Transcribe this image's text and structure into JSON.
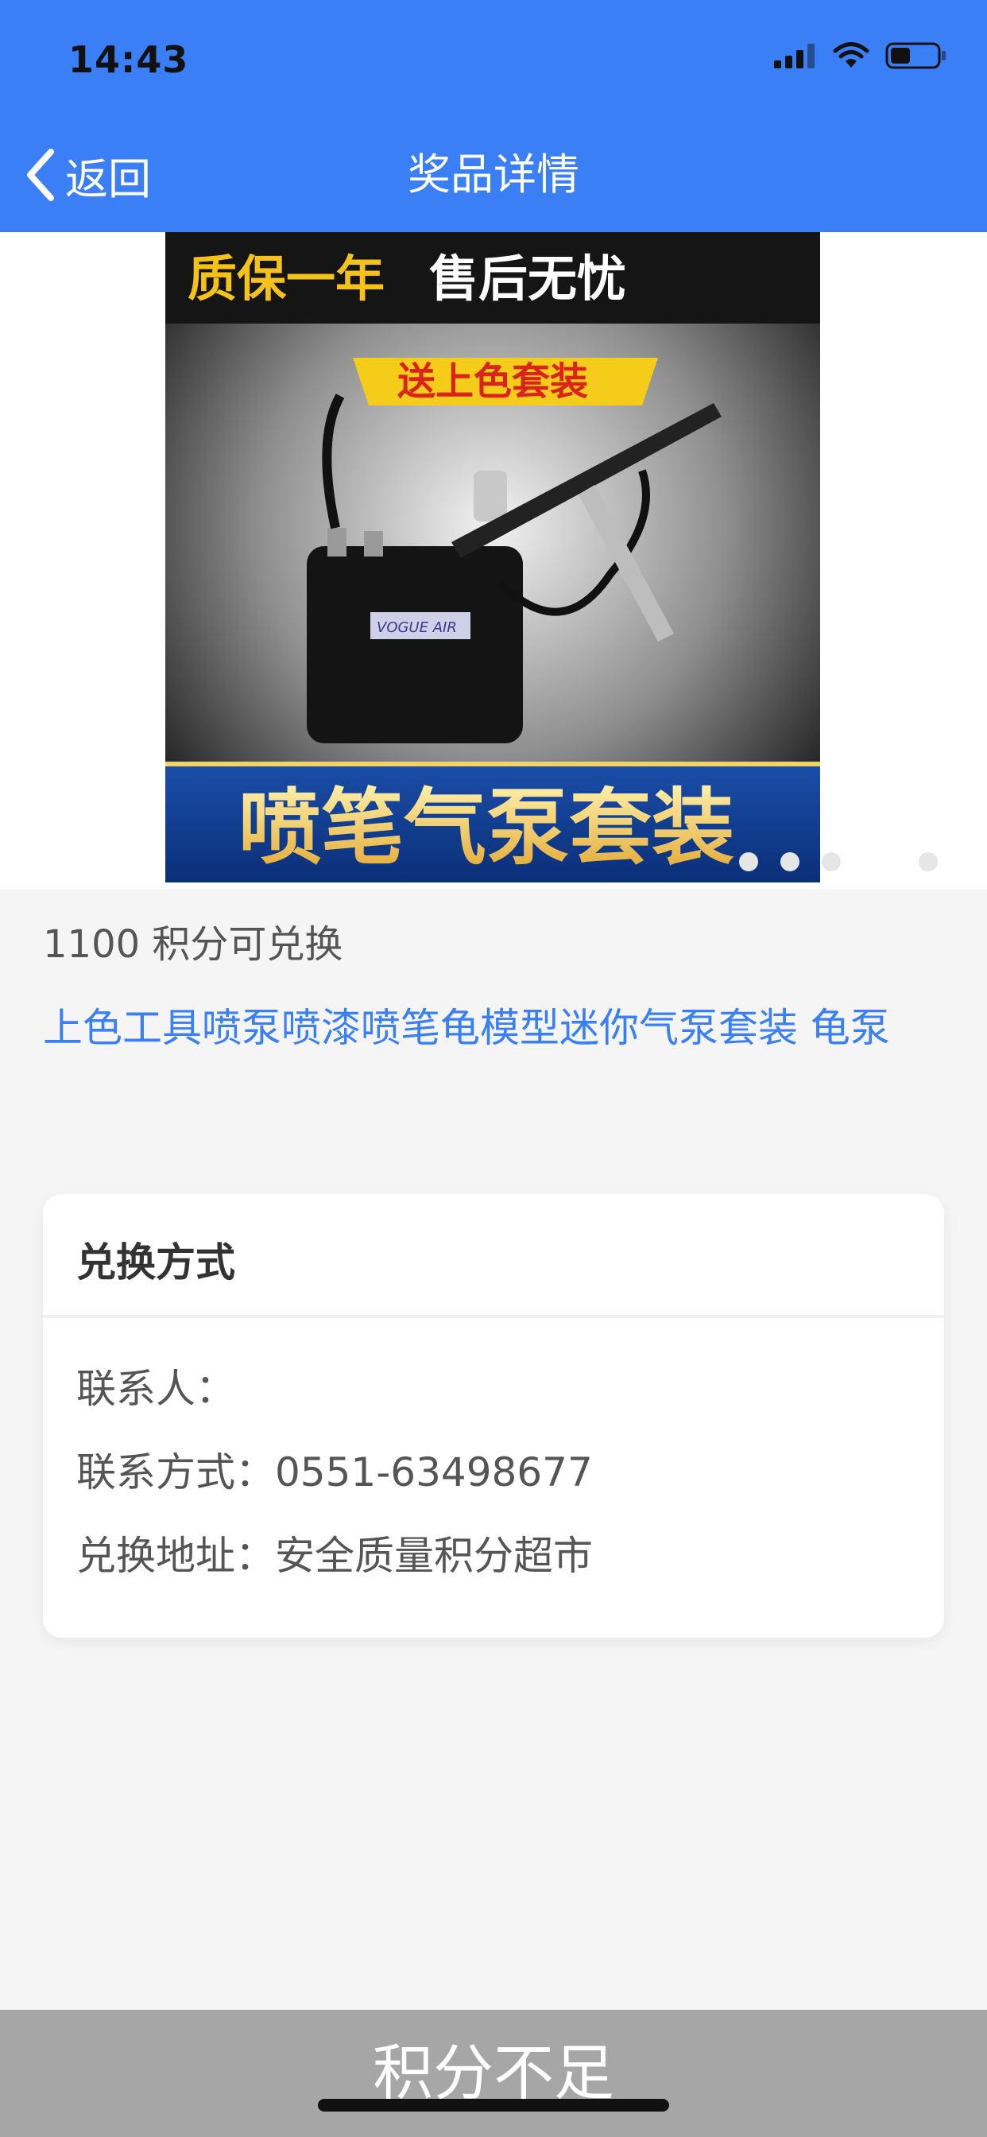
{
  "status": {
    "time": "14:43"
  },
  "nav": {
    "back_label": "返回",
    "title": "奖品详情"
  },
  "product": {
    "banner_top_left": "质保一年",
    "banner_top_right": "售后无忧",
    "ribbon": "送上色套装",
    "brand": "VOGUE AIR",
    "banner_bottom": "喷笔气泵套装",
    "points_text": "1100 积分可兑换",
    "name": "上色工具喷泵喷漆喷笔龟模型迷你气泵套装 龟泵"
  },
  "exchange": {
    "title": "兑换方式",
    "contact_person": "联系人：",
    "contact_method": "联系方式：0551-63498677",
    "address": "兑换地址：安全质量积分超市"
  },
  "bottom": {
    "button_label": "积分不足"
  },
  "colors": {
    "accent": "#3a7ff6",
    "disabled": "#a6a6a6",
    "background": "#f5f5f5"
  }
}
